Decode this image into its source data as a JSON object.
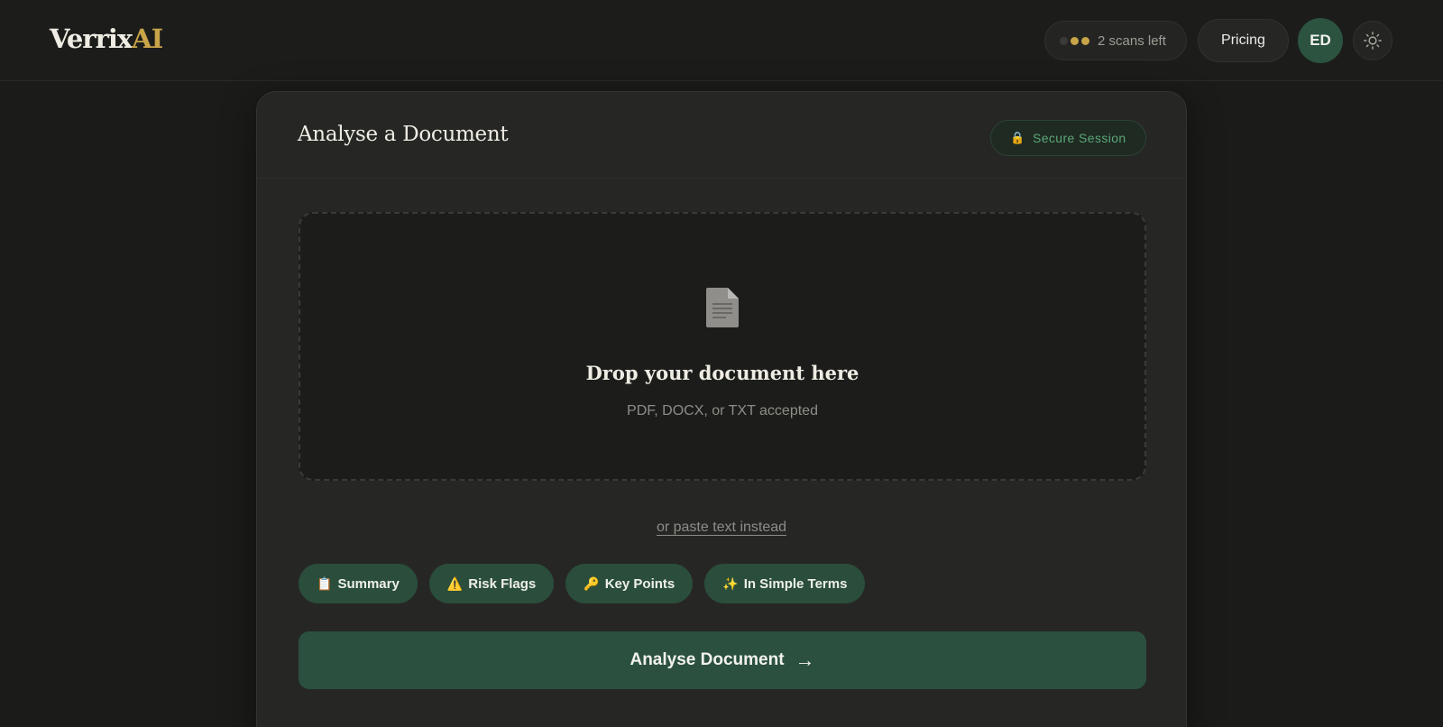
{
  "header": {
    "logo_main": "Verrix",
    "logo_accent": "AI",
    "scans_label": "2 scans left",
    "pricing_label": "Pricing",
    "avatar_initials": "ED",
    "theme_toggle_icon": "sun-icon"
  },
  "card": {
    "title": "Analyse a Document",
    "secure_label": "Secure Session",
    "secure_icon": "lock-icon"
  },
  "dropzone": {
    "icon": "document-icon",
    "title": "Drop your document here",
    "subtitle": "PDF, DOCX, or TXT accepted"
  },
  "paste_link": "or paste text instead",
  "options": [
    {
      "icon": "clipboard-icon",
      "glyph": "📋",
      "label": "Summary"
    },
    {
      "icon": "warning-icon",
      "glyph": "⚠️",
      "label": "Risk Flags"
    },
    {
      "icon": "key-icon",
      "glyph": "🔑",
      "label": "Key Points"
    },
    {
      "icon": "sparkles-icon",
      "glyph": "✨",
      "label": "In Simple Terms"
    }
  ],
  "analyse_button": {
    "label": "Analyse Document",
    "arrow": "→"
  },
  "colors": {
    "background": "#1b1c1a",
    "card": "#262725",
    "accent_gold": "#c9a449",
    "accent_green": "#2b5040",
    "secure_text": "#5ba777"
  }
}
